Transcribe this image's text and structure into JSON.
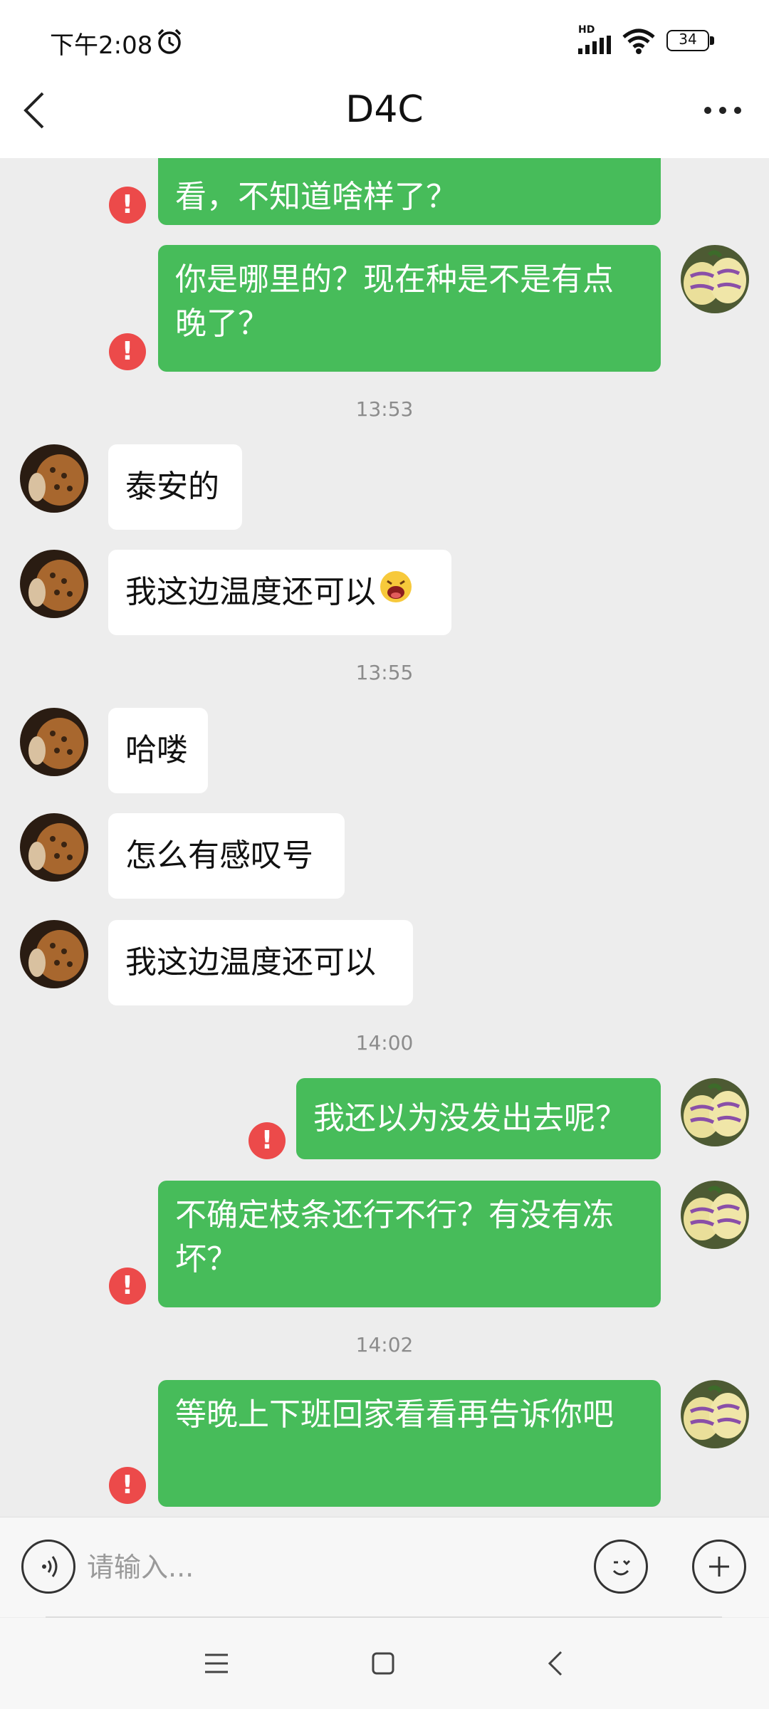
{
  "status_bar": {
    "time": "下午2:08",
    "network": "HD",
    "battery": "34"
  },
  "header": {
    "title": "D4C"
  },
  "messages": [
    {
      "side": "me",
      "text": "看，不知道啥样了？",
      "failed": true
    },
    {
      "side": "me",
      "text": "你是哪里的？现在种是不是有点晚了？",
      "failed": true
    },
    {
      "type": "time",
      "text": "13:53"
    },
    {
      "side": "them",
      "text": "泰安的"
    },
    {
      "side": "them",
      "text": "我这边温度还可以",
      "emoji": "laughing-emoji-icon"
    },
    {
      "type": "time",
      "text": "13:55"
    },
    {
      "side": "them",
      "text": "哈喽"
    },
    {
      "side": "them",
      "text": "怎么有感叹号"
    },
    {
      "side": "them",
      "text": "我这边温度还可以"
    },
    {
      "type": "time",
      "text": "14:00"
    },
    {
      "side": "me",
      "text": "我还以为没发出去呢？",
      "failed": true
    },
    {
      "side": "me",
      "text": "不确定枝条还行不行？有没有冻坏？",
      "failed": true
    },
    {
      "type": "time",
      "text": "14:02"
    },
    {
      "side": "me",
      "text": "等晚上下班回家看看再告诉你吧",
      "failed": true
    }
  ],
  "error_mark": "!",
  "input": {
    "placeholder": "请输入..."
  },
  "colors": {
    "sent_bubble": "#47bc5a",
    "received_bubble": "#ffffff",
    "error": "#ec4a4a",
    "background": "#ededed"
  }
}
